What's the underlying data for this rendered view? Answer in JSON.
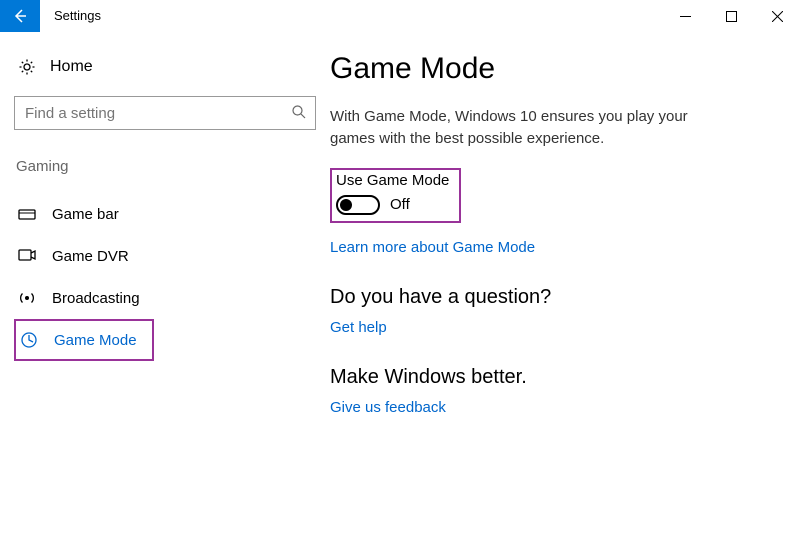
{
  "titlebar": {
    "app_title": "Settings"
  },
  "sidebar": {
    "home_label": "Home",
    "search_placeholder": "Find a setting",
    "section_label": "Gaming",
    "items": [
      {
        "label": "Game bar",
        "active": false
      },
      {
        "label": "Game DVR",
        "active": false
      },
      {
        "label": "Broadcasting",
        "active": false
      },
      {
        "label": "Game Mode",
        "active": true
      }
    ]
  },
  "main": {
    "title": "Game Mode",
    "description": "With Game Mode, Windows 10 ensures you play your games with the best possible experience.",
    "toggle": {
      "label": "Use Game Mode",
      "state": "Off"
    },
    "learn_more": "Learn more about Game Mode",
    "question_heading": "Do you have a question?",
    "get_help": "Get help",
    "better_heading": "Make Windows better.",
    "feedback": "Give us feedback"
  }
}
